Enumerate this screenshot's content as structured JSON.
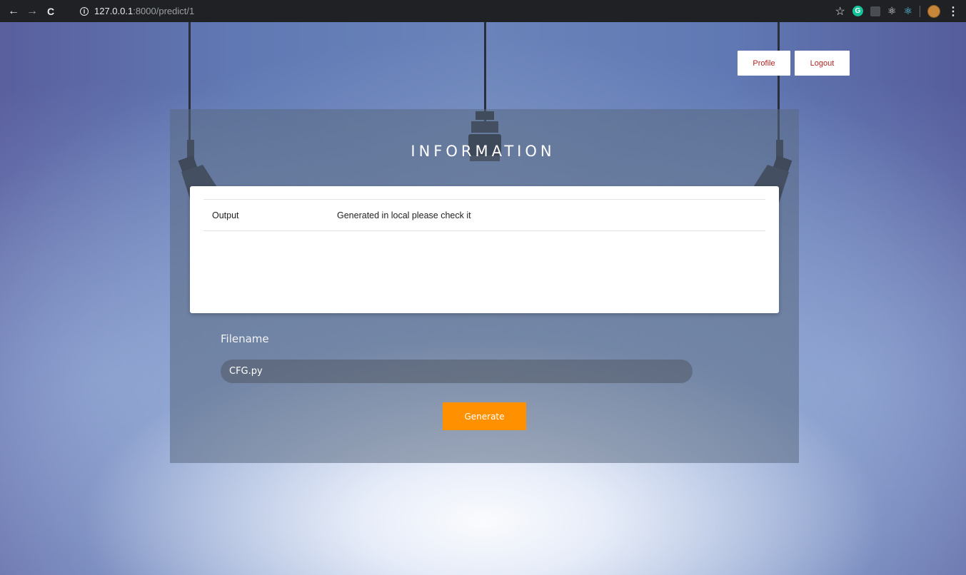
{
  "browser": {
    "url_host": "127.0.0.1",
    "url_rest": ":8000/predict/1",
    "back_icon": "←",
    "forward_icon": "→",
    "reload_icon": "C",
    "info_icon": "i",
    "star_icon": "☆",
    "extension_g": "G",
    "kebab_icon": "⋮"
  },
  "header": {
    "profile_label": "Profile",
    "logout_label": "Logout"
  },
  "main": {
    "title": "INFORMATION",
    "table": {
      "rows": [
        {
          "key": "Output",
          "value": "Generated in local please check it"
        }
      ]
    },
    "filename_label": "Filename",
    "filename_value": "CFG.py",
    "generate_label": "Generate"
  },
  "colors": {
    "accent": "#ff9000",
    "link_red": "#b22222",
    "chrome_bg": "#202124"
  }
}
